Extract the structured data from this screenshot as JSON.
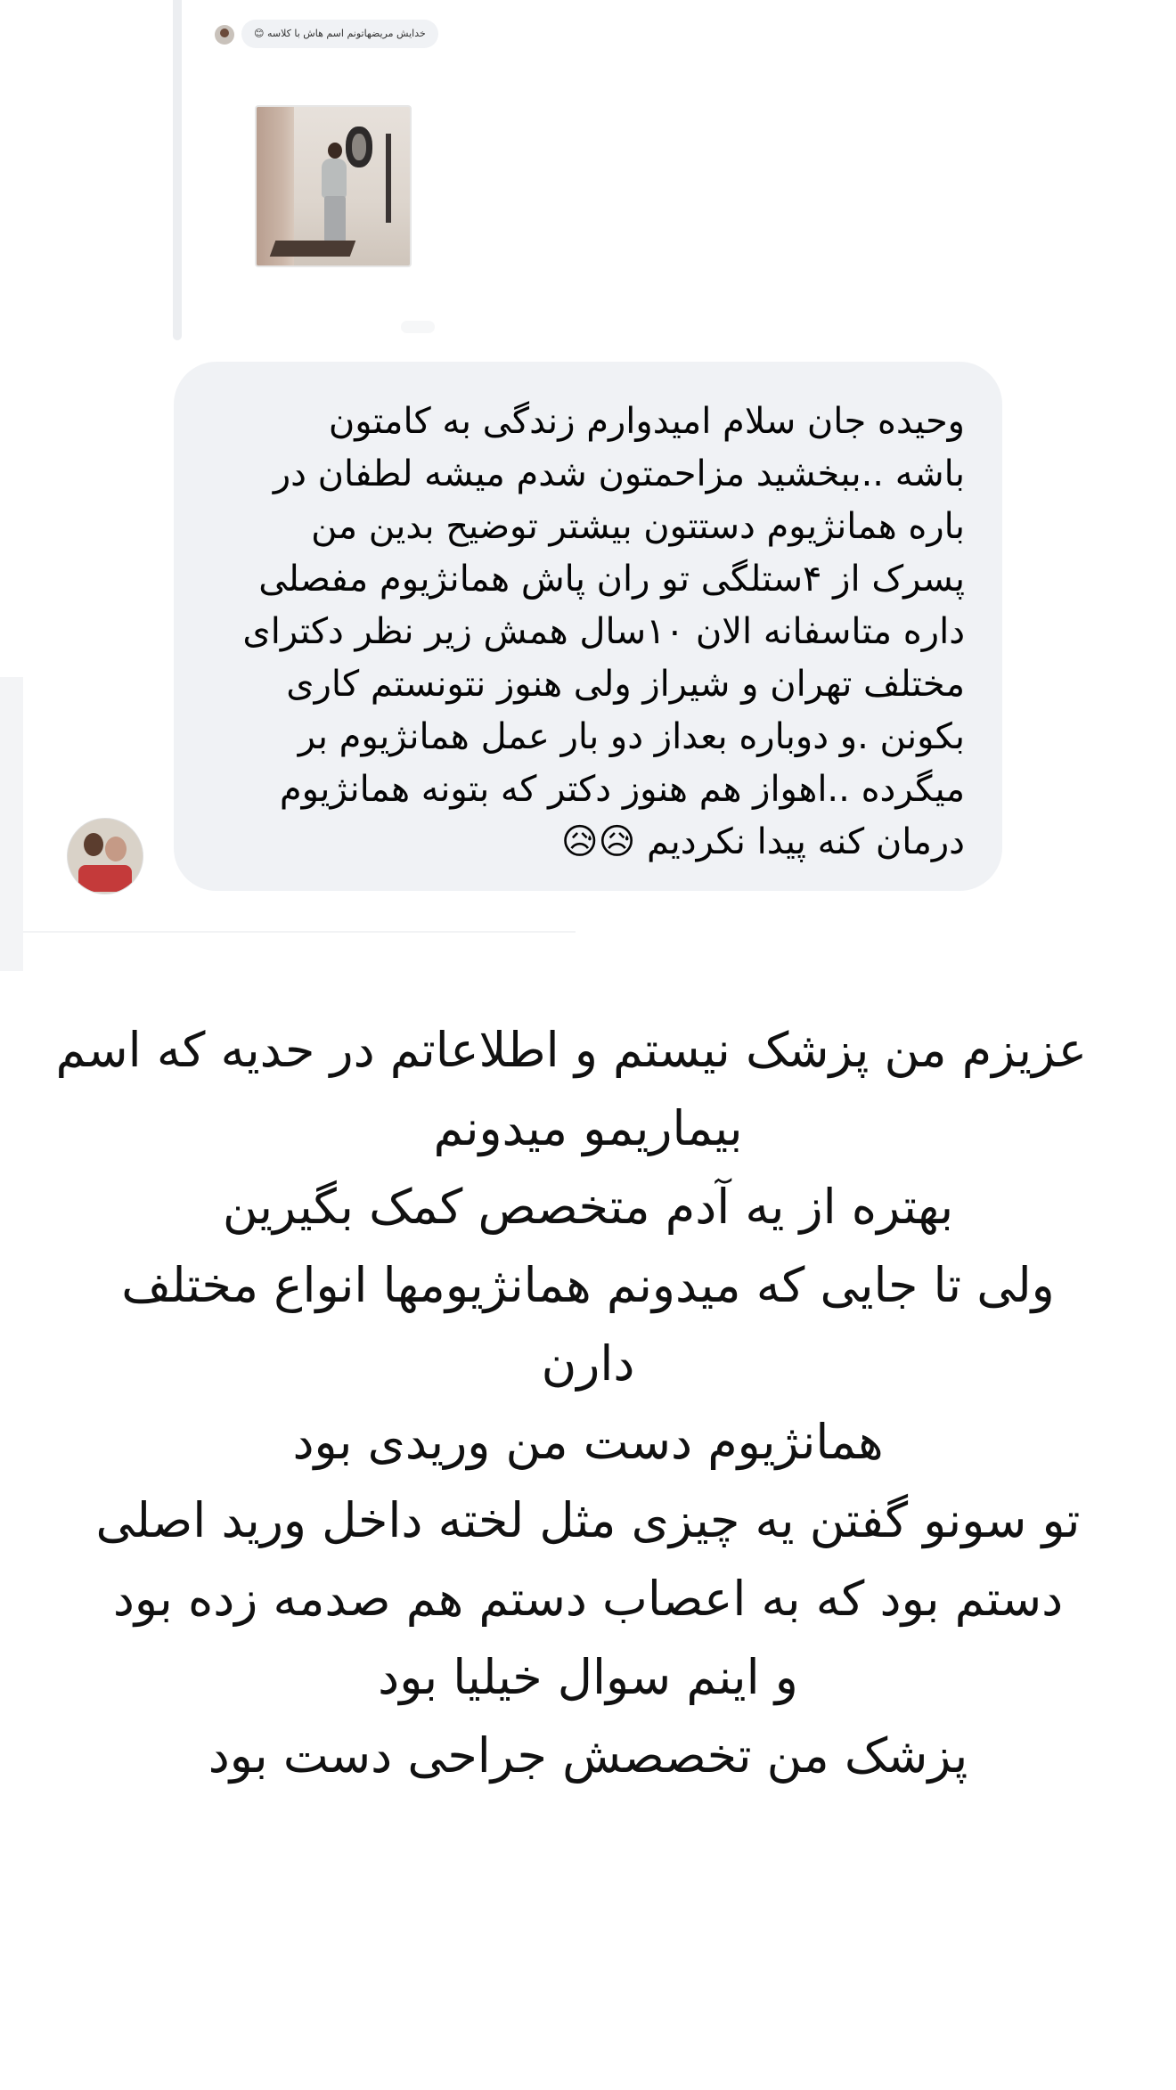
{
  "reply": {
    "text": "خدایش مریضهاتونم اسم هاش با کلاسه 😊"
  },
  "comment": {
    "lines": [
      "وحیده جان سلام امیدوارم زندگی به کامتون",
      "باشه ..ببخشید مزاحمتون شدم میشه لطفان در",
      "باره همانژیوم دستتون بیشتر توضیح بدین من",
      "پسرک از ۴ستلگی تو ران پاش همانژیوم مفصلی",
      "داره متاسفانه الان ۱۰سال همش زیر نظر دکترای",
      "مختلف تهران و شیراز ولی هنوز نتونستم کاری",
      "بکونن .و دوباره بعداز دو بار عمل  همانژیوم بر",
      "میگرده ..اهواز هم هنوز دکتر که بتونه همانژیوم",
      "درمان کنه پیدا نکردیم 😥😥"
    ]
  },
  "caption": {
    "lines": [
      "عزیزم من پزشک نیستم و اطلاعاتم در حدیه که اسم",
      "بیماریمو میدونم",
      "بهتره از یه آدم متخصص کمک بگیرین",
      "ولی تا جایی که میدونم همانژیومها انواع مختلف",
      "دارن",
      "همانژیوم دست من وریدی بود",
      "تو سونو گفتن یه چیزی مثل لخته داخل ورید اصلی",
      "دستم بود که به اعصاب دستم هم صدمه زده بود",
      "و اینم سوال خیلیا بود",
      "پزشک من تخصصش جراحی دست بود"
    ]
  }
}
